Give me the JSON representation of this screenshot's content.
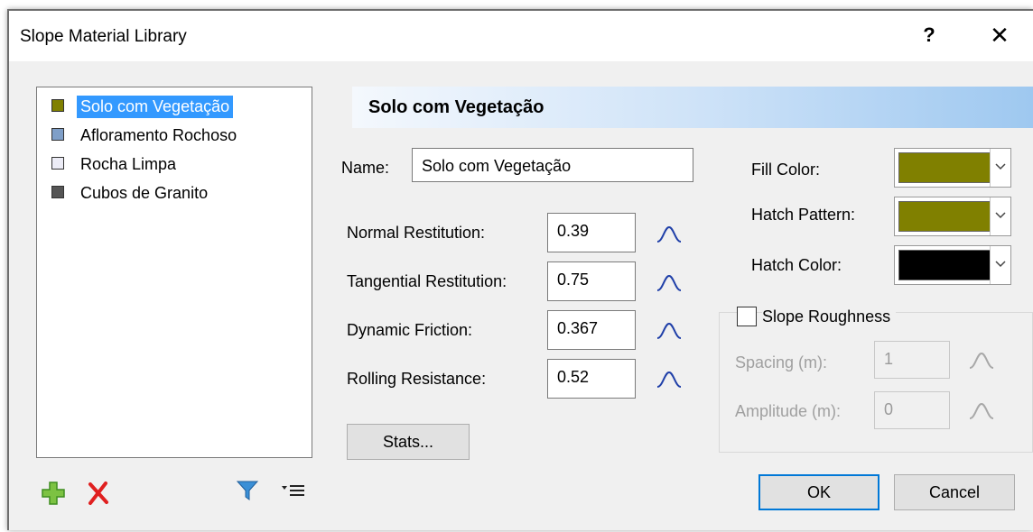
{
  "window": {
    "title": "Slope Material Library",
    "help_label": "?",
    "close_label": "✕"
  },
  "materials": [
    {
      "name": "Solo com Vegetação",
      "color": "#808000",
      "selected": true
    },
    {
      "name": "Afloramento Rochoso",
      "color": "#7f9fc8",
      "selected": false
    },
    {
      "name": "Rocha Limpa",
      "color": "#ececf6",
      "selected": false
    },
    {
      "name": "Cubos de Granito",
      "color": "#555555",
      "selected": false
    }
  ],
  "toolbar": {
    "add_icon": "plus-icon",
    "delete_icon": "x-icon",
    "filter_icon": "filter-icon",
    "sort_icon": "sort-menu-icon"
  },
  "detail": {
    "header": "Solo com Vegetação",
    "name_label": "Name:",
    "name_value": "Solo com Vegetação",
    "normal_restitution_label": "Normal Restitution:",
    "normal_restitution_value": "0.39",
    "tangential_restitution_label": "Tangential Restitution:",
    "tangential_restitution_value": "0.75",
    "dynamic_friction_label": "Dynamic Friction:",
    "dynamic_friction_value": "0.367",
    "rolling_resistance_label": "Rolling Resistance:",
    "rolling_resistance_value": "0.52",
    "stats_label": "Stats..."
  },
  "appearance": {
    "fill_color_label": "Fill Color:",
    "fill_color": "#808000",
    "hatch_pattern_label": "Hatch Pattern:",
    "hatch_pattern_color": "#808000",
    "hatch_color_label": "Hatch Color:",
    "hatch_color": "#000000"
  },
  "roughness": {
    "label": "Slope Roughness",
    "checked": false,
    "spacing_label": "Spacing (m):",
    "spacing_value": "1",
    "amplitude_label": "Amplitude (m):",
    "amplitude_value": "0"
  },
  "buttons": {
    "ok": "OK",
    "cancel": "Cancel"
  }
}
